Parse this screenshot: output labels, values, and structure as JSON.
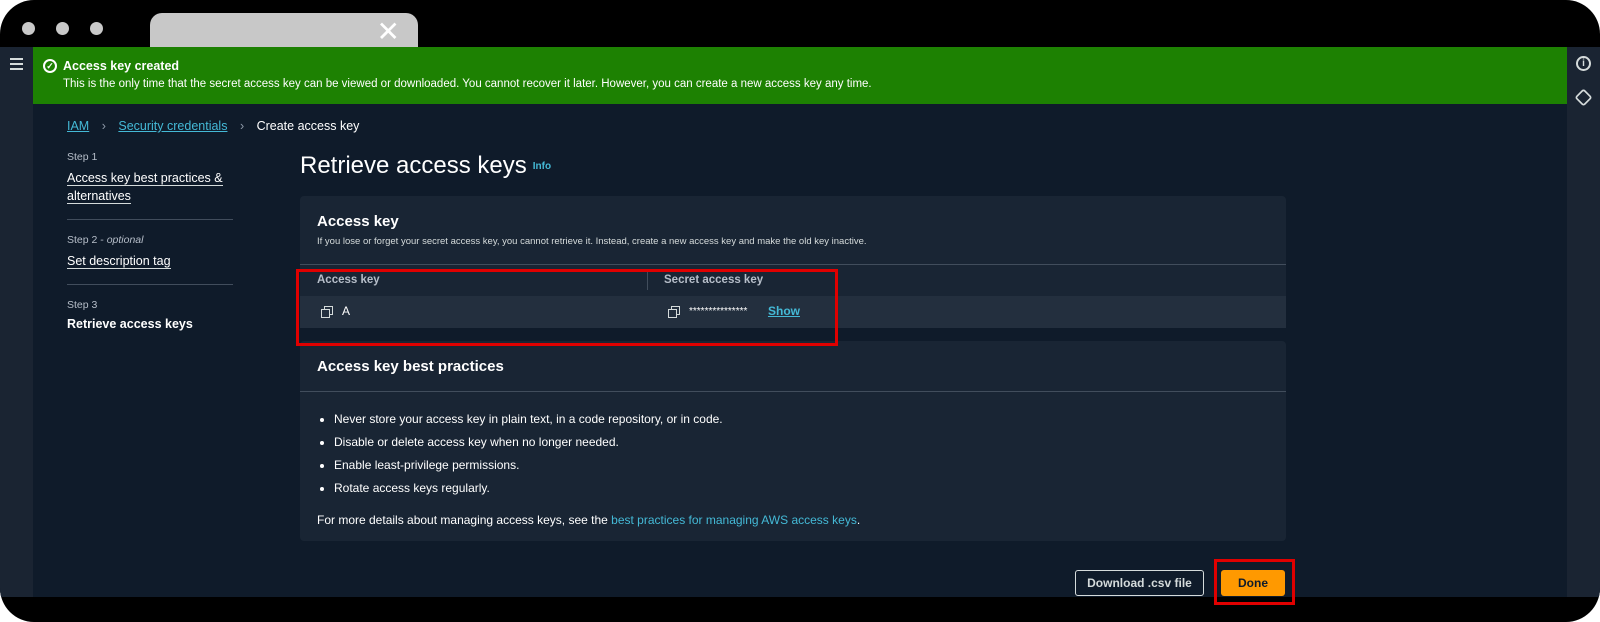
{
  "browser": {
    "tab_close_icon": "close-icon"
  },
  "flash": {
    "title": "Access key created",
    "message": "This is the only time that the secret access key can be viewed or downloaded. You cannot recover it later. However, you can create a new access key any time.",
    "color": "#1d8102"
  },
  "breadcrumb": {
    "items": [
      "IAM",
      "Security credentials",
      "Create access key"
    ]
  },
  "steps": [
    {
      "label": "Step 1",
      "title": "Access key best practices & alternatives"
    },
    {
      "label": "Step 2",
      "qualifier": "optional",
      "title": "Set description tag"
    },
    {
      "label": "Step 3",
      "title": "Retrieve access keys"
    }
  ],
  "page": {
    "title": "Retrieve access keys",
    "info": "Info"
  },
  "access_key_panel": {
    "title": "Access key",
    "description": "If you lose or forget your secret access key, you cannot retrieve it. Instead, create a new access key and make the old key inactive.",
    "columns": [
      "Access key",
      "Secret access key"
    ],
    "row": {
      "access_key": "A",
      "secret_masked": "***************",
      "show_label": "Show"
    }
  },
  "best_practices": {
    "title": "Access key best practices",
    "items": [
      "Never store your access key in plain text, in a code repository, or in code.",
      "Disable or delete access key when no longer needed.",
      "Enable least-privilege permissions.",
      "Rotate access keys regularly."
    ],
    "footer_prefix": "For more details about managing access keys, see the ",
    "footer_link": "best practices for managing AWS access keys",
    "footer_suffix": "."
  },
  "actions": {
    "download": "Download .csv file",
    "done": "Done"
  },
  "colors": {
    "accent": "#44b9d6",
    "primary_button": "#ff9900",
    "highlight": "#e00000",
    "background": "#0f1b2a"
  }
}
